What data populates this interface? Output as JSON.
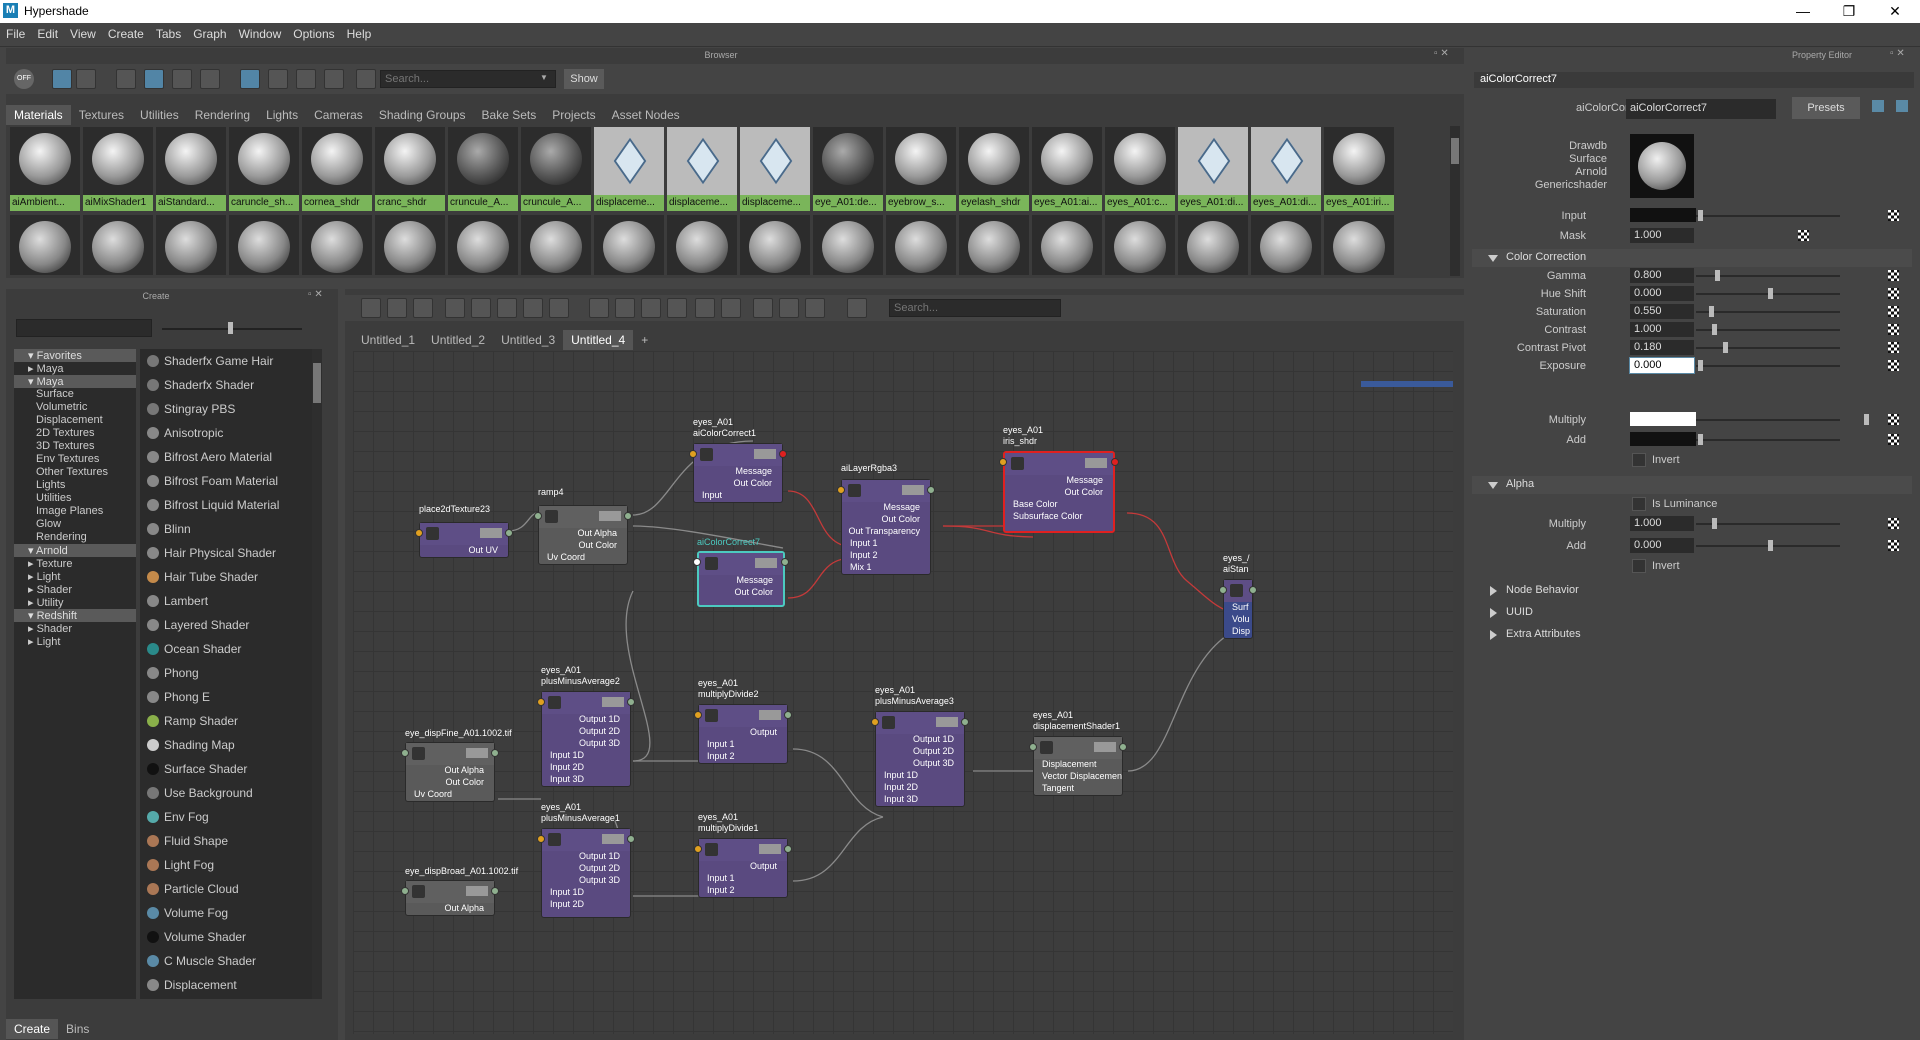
{
  "window": {
    "title": "Hypershade",
    "logo": "M",
    "minimize": "—",
    "maximize": "❐",
    "close": "✕"
  },
  "menu": [
    "File",
    "Edit",
    "View",
    "Create",
    "Tabs",
    "Graph",
    "Window",
    "Options",
    "Help"
  ],
  "browser": {
    "title": "Browser",
    "search_placeholder": "Search...",
    "show": "Show",
    "off": "OFF",
    "tabs": [
      "Materials",
      "Textures",
      "Utilities",
      "Rendering",
      "Lights",
      "Cameras",
      "Shading Groups",
      "Bake Sets",
      "Projects",
      "Asset Nodes"
    ],
    "row1": [
      {
        "label": "aiAmbient...",
        "type": "ball"
      },
      {
        "label": "aiMixShader1",
        "type": "ball"
      },
      {
        "label": "aiStandard...",
        "type": "ball"
      },
      {
        "label": "caruncle_sh...",
        "type": "ball"
      },
      {
        "label": "cornea_shdr",
        "type": "ball"
      },
      {
        "label": "cranc_shdr",
        "type": "ball"
      },
      {
        "label": "cruncule_A...",
        "type": "dark"
      },
      {
        "label": "cruncule_A...",
        "type": "dark"
      },
      {
        "label": "displaceme...",
        "type": "cube"
      },
      {
        "label": "displaceme...",
        "type": "cube"
      },
      {
        "label": "displaceme...",
        "type": "cube"
      },
      {
        "label": "eye_A01:de...",
        "type": "dark"
      },
      {
        "label": "eyebrow_s...",
        "type": "ball"
      },
      {
        "label": "eyelash_shdr",
        "type": "ball"
      },
      {
        "label": "eyes_A01:ai...",
        "type": "ball"
      },
      {
        "label": "eyes_A01:c...",
        "type": "ball"
      },
      {
        "label": "eyes_A01:di...",
        "type": "cube"
      },
      {
        "label": "eyes_A01:di...",
        "type": "cube"
      },
      {
        "label": "eyes_A01:iri...",
        "type": "ball"
      }
    ]
  },
  "create": {
    "title": "Create",
    "tabs": [
      "Create",
      "Bins"
    ],
    "tree": [
      {
        "label": "Favorites",
        "hdr": true,
        "indent": 0
      },
      {
        "label": "Maya",
        "indent": 1,
        "arrow": true
      },
      {
        "label": "Maya",
        "hdr": true,
        "indent": 0
      },
      {
        "label": "Surface",
        "indent": 2
      },
      {
        "label": "Volumetric",
        "indent": 2
      },
      {
        "label": "Displacement",
        "indent": 2
      },
      {
        "label": "2D Textures",
        "indent": 2
      },
      {
        "label": "3D Textures",
        "indent": 2
      },
      {
        "label": "Env Textures",
        "indent": 2
      },
      {
        "label": "Other Textures",
        "indent": 2
      },
      {
        "label": "Lights",
        "indent": 2
      },
      {
        "label": "Utilities",
        "indent": 2
      },
      {
        "label": "Image Planes",
        "indent": 2
      },
      {
        "label": "Glow",
        "indent": 2
      },
      {
        "label": "Rendering",
        "indent": 2
      },
      {
        "label": "Arnold",
        "hdr": true,
        "indent": 0
      },
      {
        "label": "Texture",
        "indent": 1,
        "arrow": true
      },
      {
        "label": "Light",
        "indent": 1,
        "arrow": true
      },
      {
        "label": "Shader",
        "indent": 1,
        "arrow": true
      },
      {
        "label": "Utility",
        "indent": 1,
        "arrow": true
      },
      {
        "label": "Redshift",
        "hdr": true,
        "indent": 0
      },
      {
        "label": "Shader",
        "indent": 1,
        "arrow": true
      },
      {
        "label": "Light",
        "indent": 1,
        "arrow": true
      }
    ],
    "nodes": [
      "Shaderfx Game Hair",
      "Shaderfx Shader",
      "Stingray PBS",
      "Anisotropic",
      "Bifrost Aero Material",
      "Bifrost Foam Material",
      "Bifrost Liquid Material",
      "Blinn",
      "Hair Physical Shader",
      "Hair Tube Shader",
      "Lambert",
      "Layered Shader",
      "Ocean Shader",
      "Phong",
      "Phong E",
      "Ramp Shader",
      "Shading Map",
      "Surface Shader",
      "Use Background",
      "Env Fog",
      "Fluid Shape",
      "Light Fog",
      "Particle Cloud",
      "Volume Fog",
      "Volume Shader",
      "C Muscle Shader",
      "Displacement"
    ]
  },
  "graph": {
    "search_placeholder": "Search...",
    "tabs": [
      "Untitled_1",
      "Untitled_2",
      "Untitled_3",
      "Untitled_4",
      "+"
    ],
    "nodes": [
      {
        "id": "place2d",
        "label": "place2dTexture23",
        "rows": [
          "Out UV"
        ]
      },
      {
        "id": "ramp4",
        "label": "ramp4",
        "rows": [
          "Out Alpha",
          "Out Color",
          "Uv Coord"
        ]
      },
      {
        "id": "cc1",
        "label": "eyes_A01\naiColorCorrect1",
        "rows": [
          "Message",
          "Out Color",
          "Input"
        ]
      },
      {
        "id": "cc7",
        "label": "aiColorCorrect7",
        "rows": [
          "Message",
          "Out Color"
        ]
      },
      {
        "id": "lr",
        "label": "aiLayerRgba3",
        "rows": [
          "Message",
          "Out Color",
          "Out Transparency",
          "Input 1",
          "Input 2",
          "Mix 1"
        ]
      },
      {
        "id": "iris",
        "label": "eyes_A01\niris_shdr",
        "rows": [
          "Message",
          "Out Color",
          "Base Color",
          "Subsurface Color"
        ]
      },
      {
        "id": "stan",
        "label": "eyes_/\naiStan",
        "rows": [
          "Surf",
          "Volu",
          "Disp"
        ]
      },
      {
        "id": "dfine",
        "label": "eye_dispFine_A01.1002.tif",
        "rows": [
          "Out Alpha",
          "Out Color",
          "Uv Coord"
        ]
      },
      {
        "id": "pma2",
        "label": "eyes_A01\nplusMinusAverage2",
        "rows": [
          "Output 1D",
          "Output 2D",
          "Output 3D",
          "Input 1D",
          "Input 2D",
          "Input 3D"
        ]
      },
      {
        "id": "md2",
        "label": "eyes_A01\nmultiplyDivide2",
        "rows": [
          "Output",
          "Input 1",
          "Input 2"
        ]
      },
      {
        "id": "pma3",
        "label": "eyes_A01\nplusMinusAverage3",
        "rows": [
          "Output 1D",
          "Output 2D",
          "Output 3D",
          "Input 1D",
          "Input 2D",
          "Input 3D"
        ]
      },
      {
        "id": "disp",
        "label": "eyes_A01\ndisplacementShader1",
        "rows": [
          "Displacement",
          "Vector Displacement",
          "Tangent"
        ]
      },
      {
        "id": "pma1",
        "label": "eyes_A01\nplusMinusAverage1",
        "rows": [
          "Output 1D",
          "Output 2D",
          "Output 3D",
          "Input 1D",
          "Input 2D"
        ]
      },
      {
        "id": "md1",
        "label": "eyes_A01\nmultiplyDivide1",
        "rows": [
          "Output",
          "Input 1",
          "Input 2"
        ]
      },
      {
        "id": "dbroad",
        "label": "eye_dispBroad_A01.1002.tif",
        "rows": [
          "Out Alpha"
        ]
      }
    ]
  },
  "props": {
    "title": "Property Editor",
    "tab": "aiColorCorrect7",
    "type_label": "aiColorCorrect:",
    "name": "aiColorCorrect7",
    "presets": "Presets",
    "swatch_label": "Drawdb\nSurface\nArnold\nGenericshader",
    "input_label": "Input",
    "mask_label": "Mask",
    "mask": "1.000",
    "sections": {
      "cc": "Color Correction",
      "alpha": "Alpha",
      "nb": "Node Behavior",
      "uuid": "UUID",
      "extra": "Extra Attributes"
    },
    "cc": [
      {
        "label": "Gamma",
        "value": "0.800",
        "pos": 0.12
      },
      {
        "label": "Hue Shift",
        "value": "0.000",
        "pos": 0.5
      },
      {
        "label": "Saturation",
        "value": "0.550",
        "pos": 0.08
      },
      {
        "label": "Contrast",
        "value": "1.000",
        "pos": 0.1
      },
      {
        "label": "Contrast Pivot",
        "value": "0.180",
        "pos": 0.18
      },
      {
        "label": "Exposure",
        "value": "0.000",
        "pos": 0.0
      }
    ],
    "multiply_label": "Multiply",
    "add_label": "Add",
    "invert": "Invert",
    "alpha": {
      "is_lum": "Is Luminance",
      "multiply": "1.000",
      "add": "0.000",
      "mul_pos": 0.1,
      "add_pos": 0.5
    }
  }
}
